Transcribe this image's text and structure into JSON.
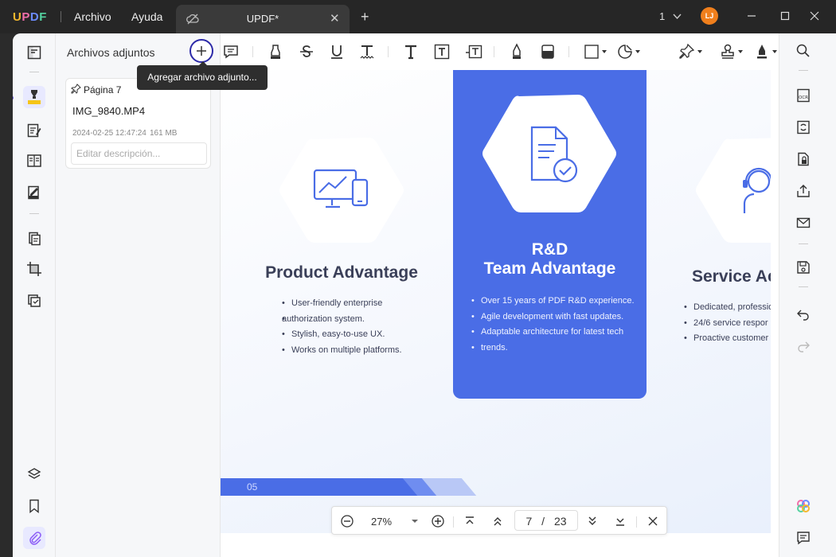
{
  "titlebar": {
    "logo_letters": [
      "U",
      "P",
      "D",
      "F"
    ],
    "menu_file": "Archivo",
    "menu_help": "Ayuda",
    "tab_title": "UPDF*",
    "page_indicator": "1",
    "avatar_initials": "LJ"
  },
  "panel": {
    "title": "Archivos adjuntos",
    "add_tooltip": "Agregar archivo adjunto...",
    "attachment": {
      "page": "Página 7",
      "filename": "IMG_9840.MP4",
      "date": "2024-02-25 12:47:24",
      "size": "161 MB",
      "description_placeholder": "Editar descripción..."
    }
  },
  "document": {
    "product": {
      "title": "Product Advantage",
      "bullets": [
        "User-friendly enterprise",
        "authorization system.",
        "Stylish, easy-to-use UX.",
        "Works on multiple platforms."
      ]
    },
    "rnd": {
      "title_line1": "R&D",
      "title_line2": "Team Advantage",
      "bullets": [
        "Over 15 years of PDF R&D experience.",
        "Agile development with fast updates.",
        "Adaptable architecture for latest tech",
        "trends."
      ]
    },
    "service": {
      "title": "Service Ac",
      "bullets": [
        "Dedicated, professio",
        "24/6 service respor",
        "Proactive customer"
      ]
    },
    "page_label": "05"
  },
  "zoombar": {
    "zoom": "27%",
    "current_page": "7",
    "separator": "/",
    "total_pages": "23"
  },
  "colors": {
    "accent": "#4a6de6",
    "titlebar": "#262626",
    "avatar": "#f07f1c",
    "add_ring": "#2c2aa8"
  }
}
